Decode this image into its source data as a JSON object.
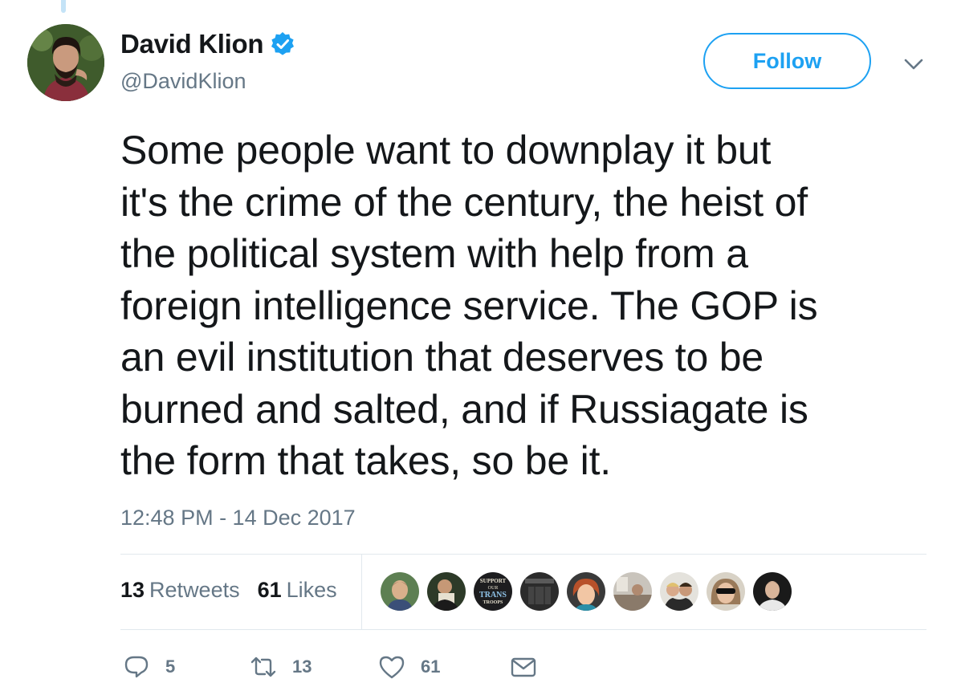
{
  "author": {
    "display_name": "David Klion",
    "handle": "@DavidKlion",
    "verified": true
  },
  "follow_label": "Follow",
  "tweet_text": "Some people want to downplay it but\nit's the crime of the century, the heist of\nthe political system with help from a\nforeign intelligence service. The GOP is\nan evil institution that deserves to be\nburned and salted, and if Russiagate is\nthe form that takes, so be it.",
  "timestamp": "12:48 PM - 14 Dec 2017",
  "stats": {
    "retweets_count": "13",
    "retweets_label": "Retweets",
    "likes_count": "61",
    "likes_label": "Likes"
  },
  "liker_avatar_texts": [
    "SUPPORT",
    "OUR",
    "TRANS",
    "TROOPS"
  ],
  "actions": {
    "reply_count": "5",
    "retweet_count": "13",
    "like_count": "61"
  },
  "colors": {
    "accent": "#1da1f2",
    "text_primary": "#14171a",
    "text_secondary": "#657786",
    "divider": "#e1e8ed"
  },
  "icons": [
    "verified-badge-icon",
    "chevron-down-icon",
    "reply-icon",
    "retweet-icon",
    "like-icon",
    "direct-message-icon"
  ]
}
